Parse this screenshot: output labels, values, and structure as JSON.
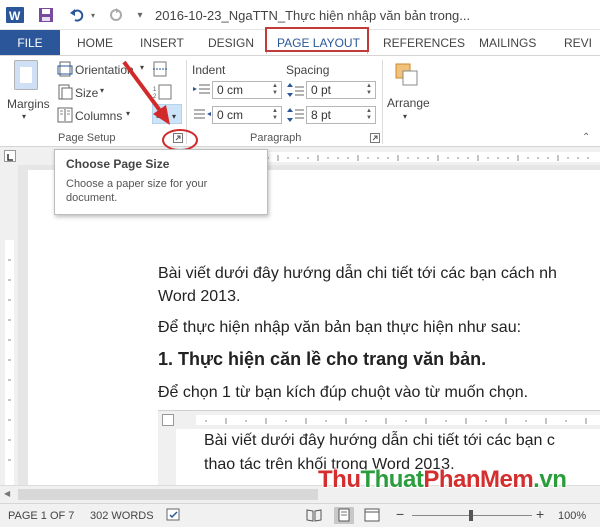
{
  "titlebar": {
    "title": "2016-10-23_NgaTTN_Thực hiện nhập văn bản trong..."
  },
  "tabs": {
    "file": "FILE",
    "home": "HOME",
    "insert": "INSERT",
    "design": "DESIGN",
    "page_layout": "PAGE LAYOUT",
    "references": "REFERENCES",
    "mailings": "MAILINGS",
    "review": "REVI"
  },
  "ribbon": {
    "margins": "Margins",
    "orientation": "Orientation",
    "size": "Size",
    "columns": "Columns",
    "page_setup_group": "Page Setup",
    "indent_label": "Indent",
    "spacing_label": "Spacing",
    "indent_left": "0 cm",
    "indent_right": "0 cm",
    "spacing_before": "0 pt",
    "spacing_after": "8 pt",
    "paragraph_group": "Paragraph",
    "arrange": "Arrange"
  },
  "tooltip": {
    "title": "Choose Page Size",
    "description": "Choose a paper size for your document."
  },
  "document": {
    "line1": "Bài viết dưới đây hướng dẫn chi tiết tới các bạn cách nh",
    "line2": "Word 2013.",
    "line3": "Để thực hiện nhập văn bản bạn thực hiện như sau:",
    "heading": "1. Thực hiện căn lề cho trang văn bản.",
    "line4": "Để chọn 1 từ bạn kích đúp chuột vào từ muốn chọn.",
    "embed_line1": "Bài viết dưới đây hướng dẫn chi tiết tới các bạn c",
    "embed_line2": "thao tác trên khối trong Word 2013."
  },
  "statusbar": {
    "page": "PAGE 1 OF 7",
    "words": "302 WORDS",
    "zoom": "100%"
  },
  "watermark": {
    "part1": "Thu",
    "part2": "Thuat",
    "part3": "PhanMem",
    "part4": ".vn"
  },
  "colors": {
    "word_blue": "#2b579a",
    "highlight_red": "#c23b3b",
    "arrow_red": "#d22a2a"
  }
}
